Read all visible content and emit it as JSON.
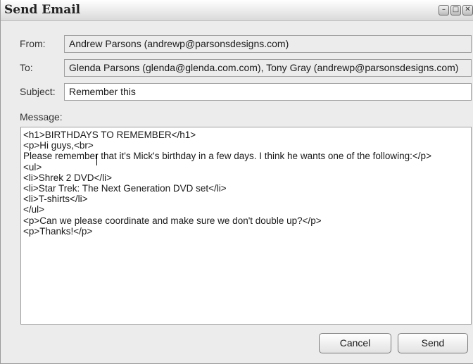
{
  "window": {
    "title": "Send Email",
    "controls": {
      "minimize_glyph": "–",
      "maximize_glyph": "□",
      "close_glyph": "✕"
    }
  },
  "form": {
    "from": {
      "label": "From:",
      "value": "Andrew Parsons (andrewp@parsonsdesigns.com)"
    },
    "to": {
      "label": "To:",
      "value": "Glenda Parsons (glenda@glenda.com.com), Tony Gray (andrewp@parsonsdesigns.com)"
    },
    "subject": {
      "label": "Subject:",
      "value": "Remember this"
    },
    "message": {
      "label": "Message:",
      "lines": [
        "<h1>BIRTHDAYS TO REMEMBER</h1>",
        "<p>Hi guys,<br>",
        "Please remember that it's Mick's birthday in a few days. I think he wants one of the following:</p>",
        "<ul>",
        "<li>Shrek 2 DVD</li>",
        "<li>Star Trek: The Next Generation DVD set</li>",
        "<li>T-shirts</li>",
        "</ul>",
        "<p>Can we please coordinate and make sure we don't double up?</p>",
        "<p>Thanks!</p>"
      ]
    }
  },
  "buttons": {
    "cancel": "Cancel",
    "send": "Send"
  }
}
